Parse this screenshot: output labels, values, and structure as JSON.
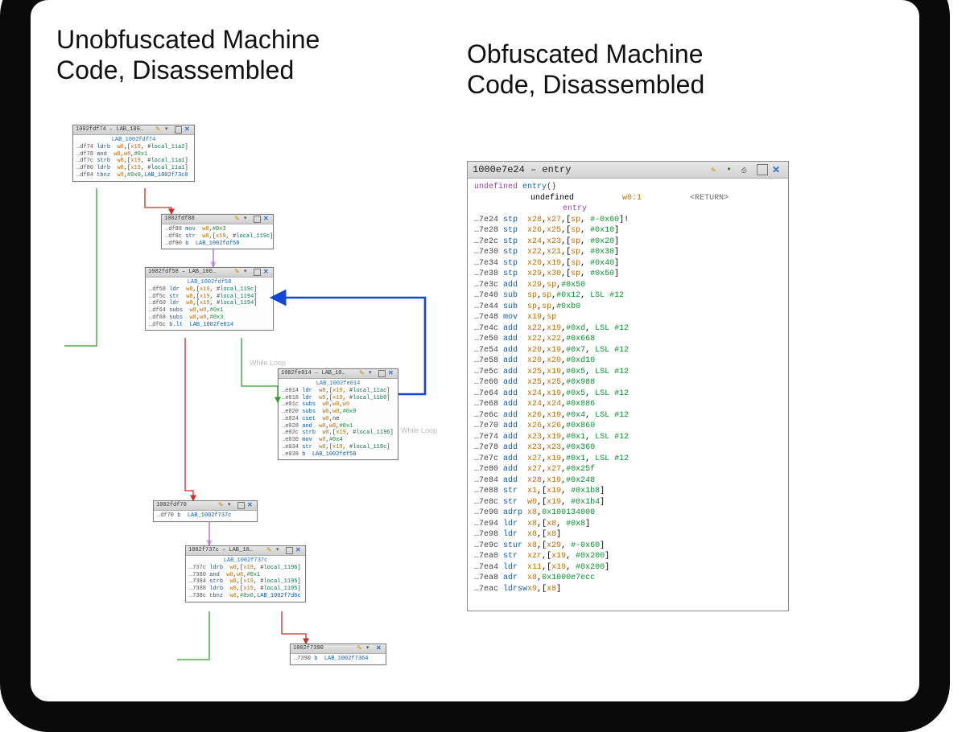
{
  "headings": {
    "left": "Unobfuscated Machine Code, Disassembled",
    "right": "Obfuscated Machine Code, Disassembled"
  },
  "while_loop_label": "While Loop",
  "cfg": {
    "b1": {
      "title": "1002fdf74 – LAB_100…",
      "label": "LAB_1002fdf74",
      "rows": [
        {
          "addr": "…df74",
          "mne": "ldrb",
          "args": "w8,[x19, #local_11a2]"
        },
        {
          "addr": "…df78",
          "mne": "and",
          "args": "w8,w8,#0x1"
        },
        {
          "addr": "…df7c",
          "mne": "strb",
          "args": "w8,[x19, #local_11a1]"
        },
        {
          "addr": "…df80",
          "mne": "ldrb",
          "args": "w8,[x19, #local_11a1]"
        },
        {
          "addr": "…df84",
          "mne": "tbnz",
          "args": "w8,#0x0,LAB_1002f73c8"
        }
      ]
    },
    "b2": {
      "title": "1002fdf88",
      "rows": [
        {
          "addr": "…df88",
          "mne": "mov",
          "args": "w8,#0x3"
        },
        {
          "addr": "…df8c",
          "mne": "str",
          "args": "w8,[x19, #local_119c]"
        },
        {
          "addr": "…df90",
          "mne": "b",
          "args": "LAB_1002fdf58"
        }
      ]
    },
    "b3": {
      "title": "1002fdf58 – LAB_100…",
      "label": "LAB_1002fdf58",
      "rows": [
        {
          "addr": "…df58",
          "mne": "ldr",
          "args": "w8,[x19, #local_119c]"
        },
        {
          "addr": "…df5c",
          "mne": "str",
          "args": "w8,[x19, #local_1194]"
        },
        {
          "addr": "…df60",
          "mne": "ldr",
          "args": "w8,[x19, #local_1194]"
        },
        {
          "addr": "…df64",
          "mne": "subs",
          "args": "w8,w8,#0x1"
        },
        {
          "addr": "…df68",
          "mne": "subs",
          "args": "w8,w8,#0x3"
        },
        {
          "addr": "…df6c",
          "mne": "b.lt",
          "args": "LAB_1002fe014"
        }
      ]
    },
    "b4": {
      "title": "1002fe014 – LAB_10…",
      "label": "LAB_1002fe014",
      "rows": [
        {
          "addr": "…e014",
          "mne": "ldr",
          "args": "w8,[x19, #local_11ac]"
        },
        {
          "addr": "…e018",
          "mne": "ldr",
          "args": "w9,[x19, #local_11b0]"
        },
        {
          "addr": "…e01c",
          "mne": "subs",
          "args": "w8,w8,w9"
        },
        {
          "addr": "…e020",
          "mne": "subs",
          "args": "w8,w8,#0x0"
        },
        {
          "addr": "…e024",
          "mne": "cset",
          "args": "w8,ne"
        },
        {
          "addr": "…e028",
          "mne": "and",
          "args": "w8,w8,#0x1"
        },
        {
          "addr": "…e02c",
          "mne": "strb",
          "args": "w8,[x19, #local_1196]"
        },
        {
          "addr": "…e030",
          "mne": "mov",
          "args": "w8,#0x4"
        },
        {
          "addr": "…e034",
          "mne": "str",
          "args": "w8,[x19, #local_119c]"
        },
        {
          "addr": "…e038",
          "mne": "b",
          "args": "LAB_1002fdf58"
        }
      ]
    },
    "b5": {
      "title": "1002fdf70",
      "rows": [
        {
          "addr": "…df70",
          "mne": "b",
          "args": "LAB_1002f737c"
        }
      ]
    },
    "b6": {
      "title": "1002f737c – LAB_10…",
      "label": "LAB_1002f737c",
      "rows": [
        {
          "addr": "…737c",
          "mne": "ldrb",
          "args": "w8,[x19, #local_1196]"
        },
        {
          "addr": "…7380",
          "mne": "and",
          "args": "w8,w8,#0x1"
        },
        {
          "addr": "…7384",
          "mne": "strb",
          "args": "w8,[x19, #local_1195]"
        },
        {
          "addr": "…7388",
          "mne": "ldrb",
          "args": "w8,[x19, #local_1195]"
        },
        {
          "addr": "…738c",
          "mne": "tbnz",
          "args": "w8,#0x0,LAB_1002f7d6c"
        }
      ]
    },
    "b7": {
      "title": "1002f7390",
      "rows": [
        {
          "addr": "…7390",
          "mne": "b",
          "args": "LAB_1002f7364"
        }
      ]
    }
  },
  "obfuscated": {
    "title": "1000e7e24 – entry",
    "signature": {
      "type": "undefined",
      "name": "entry",
      "params": "()",
      "ret_type": "undefined",
      "ret_reg": "w0:1",
      "ret_tag": "<RETURN>"
    },
    "entry_label": "entry",
    "rows": [
      {
        "addr": "…7e24",
        "mne": "stp",
        "args": "x28,x27,[sp, #-0x60]!"
      },
      {
        "addr": "…7e28",
        "mne": "stp",
        "args": "x26,x25,[sp, #0x10]"
      },
      {
        "addr": "…7e2c",
        "mne": "stp",
        "args": "x24,x23,[sp, #0x20]"
      },
      {
        "addr": "…7e30",
        "mne": "stp",
        "args": "x22,x21,[sp, #0x30]"
      },
      {
        "addr": "…7e34",
        "mne": "stp",
        "args": "x20,x19,[sp, #0x40]"
      },
      {
        "addr": "…7e38",
        "mne": "stp",
        "args": "x29,x30,[sp, #0x50]"
      },
      {
        "addr": "…7e3c",
        "mne": "add",
        "args": "x29,sp,#0x50"
      },
      {
        "addr": "…7e40",
        "mne": "sub",
        "args": "sp,sp,#0x12, LSL #12"
      },
      {
        "addr": "…7e44",
        "mne": "sub",
        "args": "sp,sp,#0xb0"
      },
      {
        "addr": "…7e48",
        "mne": "mov",
        "args": "x19,sp"
      },
      {
        "addr": "…7e4c",
        "mne": "add",
        "args": "x22,x19,#0xd, LSL #12"
      },
      {
        "addr": "…7e50",
        "mne": "add",
        "args": "x22,x22,#0x668"
      },
      {
        "addr": "…7e54",
        "mne": "add",
        "args": "x20,x19,#0x7, LSL #12"
      },
      {
        "addr": "…7e58",
        "mne": "add",
        "args": "x20,x20,#0xd10"
      },
      {
        "addr": "…7e5c",
        "mne": "add",
        "args": "x25,x19,#0x5, LSL #12"
      },
      {
        "addr": "…7e60",
        "mne": "add",
        "args": "x25,x25,#0x988"
      },
      {
        "addr": "…7e64",
        "mne": "add",
        "args": "x24,x19,#0x5, LSL #12"
      },
      {
        "addr": "…7e68",
        "mne": "add",
        "args": "x24,x24,#0x886"
      },
      {
        "addr": "…7e6c",
        "mne": "add",
        "args": "x26,x19,#0x4, LSL #12"
      },
      {
        "addr": "…7e70",
        "mne": "add",
        "args": "x26,x26,#0x860"
      },
      {
        "addr": "…7e74",
        "mne": "add",
        "args": "x23,x19,#0x1, LSL #12"
      },
      {
        "addr": "…7e78",
        "mne": "add",
        "args": "x23,x23,#0x360"
      },
      {
        "addr": "…7e7c",
        "mne": "add",
        "args": "x27,x19,#0x1, LSL #12"
      },
      {
        "addr": "…7e80",
        "mne": "add",
        "args": "x27,x27,#0x25f"
      },
      {
        "addr": "…7e84",
        "mne": "add",
        "args": "x28,x19,#0x248"
      },
      {
        "addr": "…7e88",
        "mne": "str",
        "args": "x1,[x19, #0x1b8]"
      },
      {
        "addr": "…7e8c",
        "mne": "str",
        "args": "w0,[x19, #0x1b4]"
      },
      {
        "addr": "…7e90",
        "mne": "adrp",
        "args": "x8,0x100134000"
      },
      {
        "addr": "…7e94",
        "mne": "ldr",
        "args": "x8,[x8, #0x8]"
      },
      {
        "addr": "…7e98",
        "mne": "ldr",
        "args": "x8,[x8]"
      },
      {
        "addr": "…7e9c",
        "mne": "stur",
        "args": "x8,[x29, #-0x60]"
      },
      {
        "addr": "…7ea0",
        "mne": "str",
        "args": "xzr,[x19, #0x200]"
      },
      {
        "addr": "…7ea4",
        "mne": "ldr",
        "args": "x11,[x19, #0x200]"
      },
      {
        "addr": "…7ea8",
        "mne": "adr",
        "args": "x8,0x1000e7ecc"
      },
      {
        "addr": "…7eac",
        "mne": "ldrsw",
        "args": "x9,[x8]"
      }
    ]
  }
}
